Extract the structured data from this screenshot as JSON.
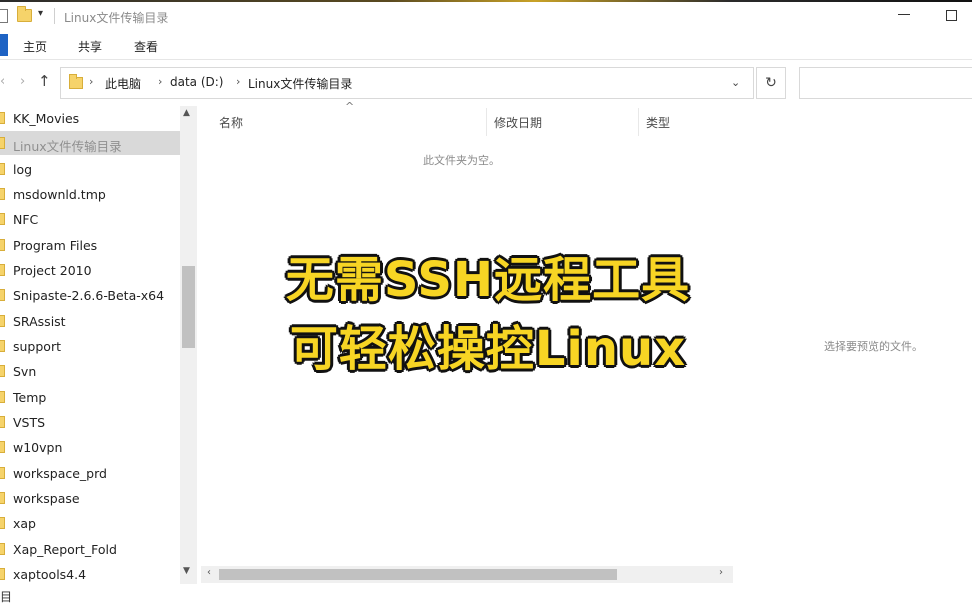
{
  "window": {
    "title": "Linux文件传输目录"
  },
  "ribbon": {
    "tabs": [
      "主页",
      "共享",
      "查看"
    ]
  },
  "address": {
    "crumbs": [
      "此电脑",
      "data (D:)",
      "Linux文件传输目录"
    ]
  },
  "sidebar": {
    "items": [
      {
        "label": "KK_Movies",
        "selected": false
      },
      {
        "label": "Linux文件传输目录",
        "selected": true
      },
      {
        "label": "log",
        "selected": false
      },
      {
        "label": "msdownld.tmp",
        "selected": false
      },
      {
        "label": "NFC",
        "selected": false
      },
      {
        "label": "Program Files",
        "selected": false
      },
      {
        "label": "Project 2010",
        "selected": false
      },
      {
        "label": "Snipaste-2.6.6-Beta-x64",
        "selected": false
      },
      {
        "label": "SRAssist",
        "selected": false
      },
      {
        "label": "support",
        "selected": false
      },
      {
        "label": "Svn",
        "selected": false
      },
      {
        "label": "Temp",
        "selected": false
      },
      {
        "label": "VSTS",
        "selected": false
      },
      {
        "label": "w10vpn",
        "selected": false
      },
      {
        "label": "workspace_prd",
        "selected": false
      },
      {
        "label": "workspase",
        "selected": false
      },
      {
        "label": "xap",
        "selected": false
      },
      {
        "label": "Xap_Report_Fold",
        "selected": false
      },
      {
        "label": "xaptools4.4",
        "selected": false
      }
    ]
  },
  "columns": [
    "名称",
    "修改日期",
    "类型"
  ],
  "content": {
    "empty_message": "此文件夹为空。"
  },
  "preview": {
    "message": "选择要预览的文件。"
  },
  "status": {
    "text": "目"
  },
  "overlay": {
    "line1": "无需SSH远程工具",
    "line2": "可轻松操控Linux"
  }
}
